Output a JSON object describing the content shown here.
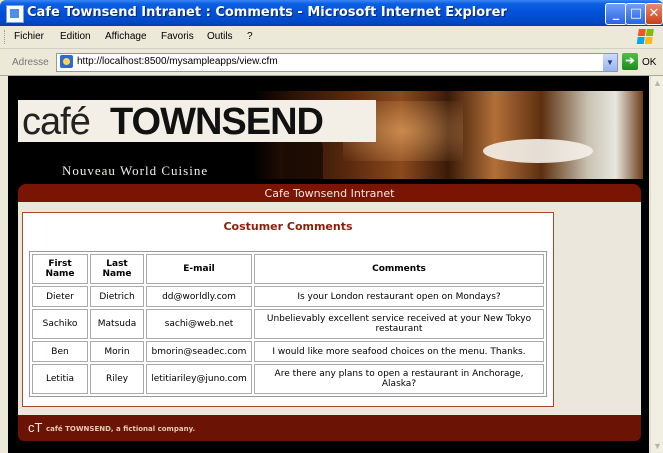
{
  "window": {
    "title": "Cafe Townsend Intranet : Comments - Microsoft Internet Explorer",
    "minimize": "_",
    "maximize": "□",
    "close": "✕"
  },
  "menu": {
    "items": [
      "Fichier",
      "Edition",
      "Affichage",
      "Favoris",
      "Outils",
      "?"
    ]
  },
  "address": {
    "label": "Adresse",
    "url": "http://localhost:8500/mysampleapps/view.cfm",
    "go_label": "OK"
  },
  "banner": {
    "logo_cafe": "café",
    "logo_townsend": "TOWNSEND",
    "tagline": "Nouveau World Cuisine"
  },
  "header_bar": {
    "title": "Cafe Townsend Intranet"
  },
  "panel": {
    "title": "Costumer Comments"
  },
  "table": {
    "headers": [
      "First Name",
      "Last Name",
      "E-mail",
      "Comments"
    ],
    "rows": [
      [
        "Dieter",
        "Dietrich",
        "dd@worldly.com",
        "Is your London restaurant open on Mondays?"
      ],
      [
        "Sachiko",
        "Matsuda",
        "sachi@web.net",
        "Unbelievably excellent service received at your New Tokyo restaurant"
      ],
      [
        "Ben",
        "Morin",
        "bmorin@seadec.com",
        "I would like more seafood choices on the menu. Thanks."
      ],
      [
        "Letitia",
        "Riley",
        "letitiariley@juno.com",
        "Are there any plans to open a restaurant in Anchorage, Alaska?"
      ]
    ]
  },
  "footer": {
    "logo": "cT",
    "text": "café TOWNSEND, a fictional company."
  }
}
